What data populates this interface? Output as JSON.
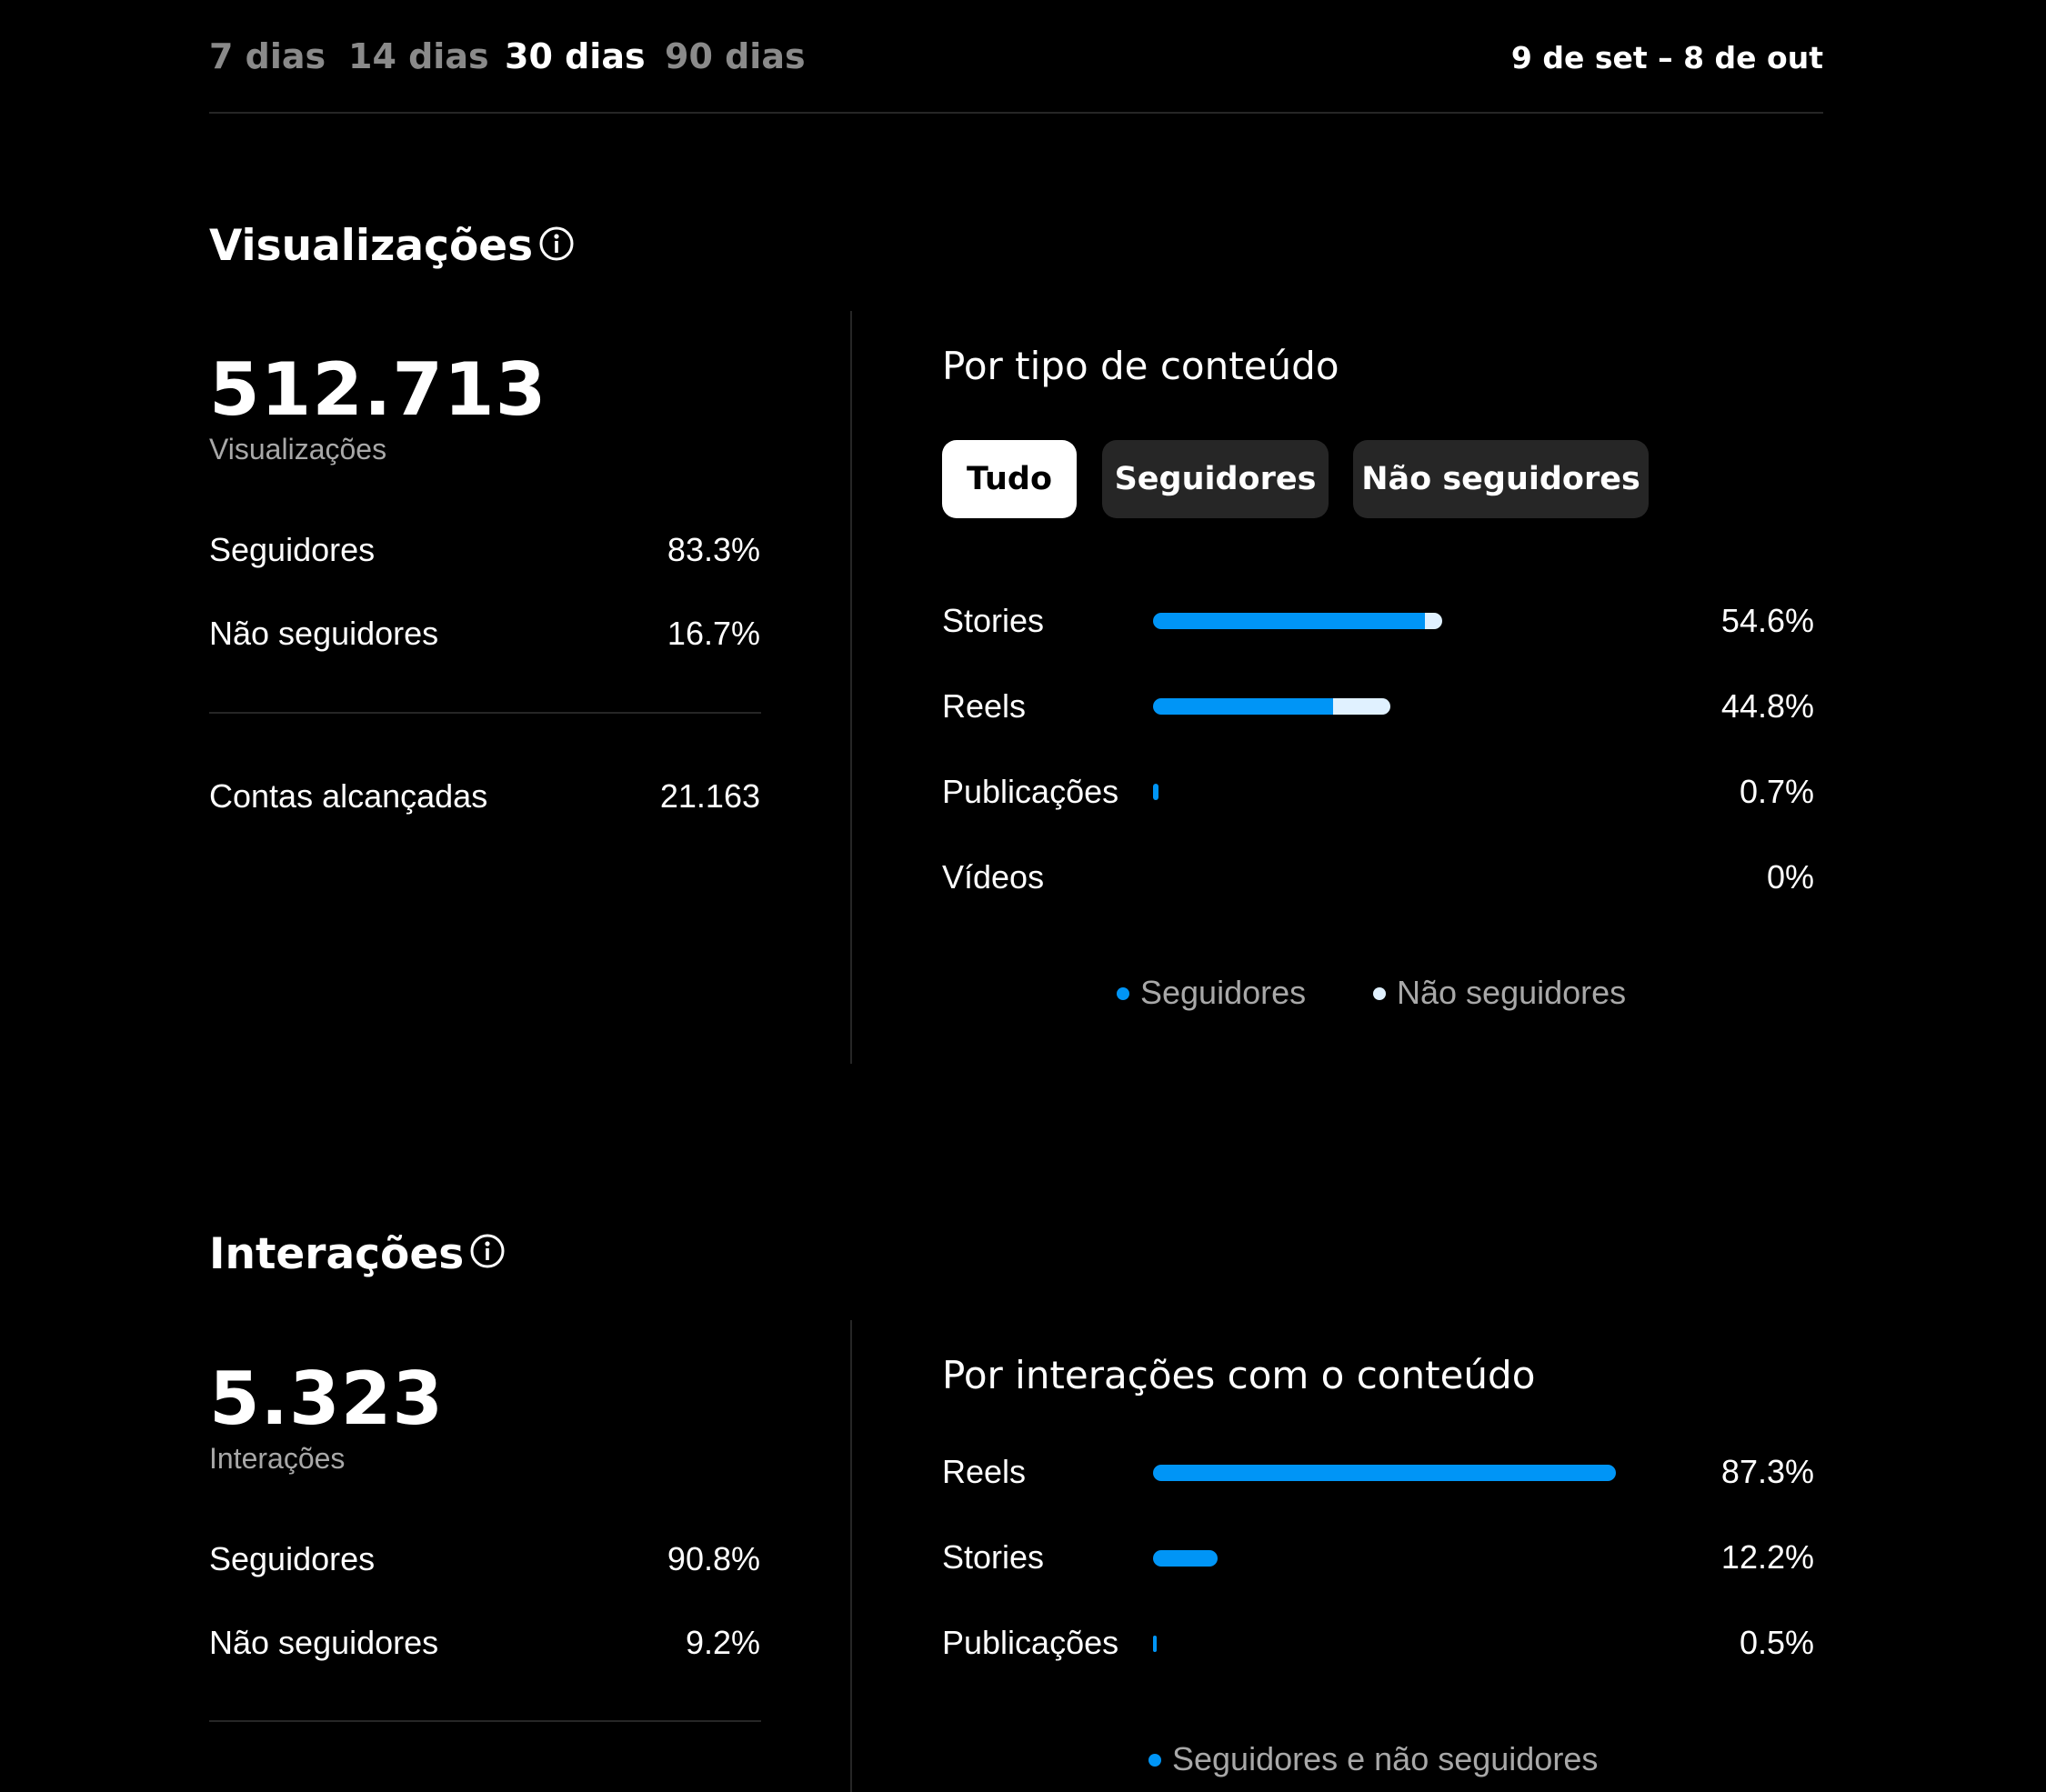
{
  "ranges": {
    "items": [
      "7 dias",
      "14 dias",
      "30 dias",
      "90 dias"
    ],
    "active_index": 2,
    "date_range": "9 de set – 8 de out"
  },
  "colors": {
    "background": "#000000",
    "followers": "#0095f6",
    "non_followers": "#e0f1ff",
    "divider": "#262626",
    "muted_text": "#a8a8a8"
  },
  "views": {
    "title": "Visualizações",
    "total": "512.713",
    "total_caption": "Visualizações",
    "followers_label": "Seguidores",
    "followers_value": "83.3%",
    "non_followers_label": "Não seguidores",
    "non_followers_value": "16.7%",
    "reached_label": "Contas alcançadas",
    "reached_value": "21.163",
    "breakdown_title": "Por tipo de conteúdo",
    "filters": [
      "Tudo",
      "Seguidores",
      "Não seguidores"
    ],
    "active_filter": 0,
    "rows": [
      {
        "label": "Stories",
        "value": "54.6%",
        "total_pct": 54.6,
        "followers_share": 0.94
      },
      {
        "label": "Reels",
        "value": "44.8%",
        "total_pct": 44.8,
        "followers_share": 0.76
      },
      {
        "label": "Publicações",
        "value": "0.7%",
        "total_pct": 0.7,
        "followers_share": 0.6
      },
      {
        "label": "Vídeos",
        "value": "0%",
        "total_pct": 0,
        "followers_share": 0
      }
    ],
    "legend": [
      "Seguidores",
      "Não seguidores"
    ]
  },
  "interactions": {
    "title": "Interações",
    "total": "5.323",
    "total_caption": "Interações",
    "followers_label": "Seguidores",
    "followers_value": "90.8%",
    "non_followers_label": "Não seguidores",
    "non_followers_value": "9.2%",
    "breakdown_title": "Por interações com o conteúdo",
    "rows": [
      {
        "label": "Reels",
        "value": "87.3%",
        "total_pct": 87.3
      },
      {
        "label": "Stories",
        "value": "12.2%",
        "total_pct": 12.2
      },
      {
        "label": "Publicações",
        "value": "0.5%",
        "total_pct": 0.5
      }
    ],
    "legend": [
      "Seguidores e não seguidores"
    ]
  }
}
